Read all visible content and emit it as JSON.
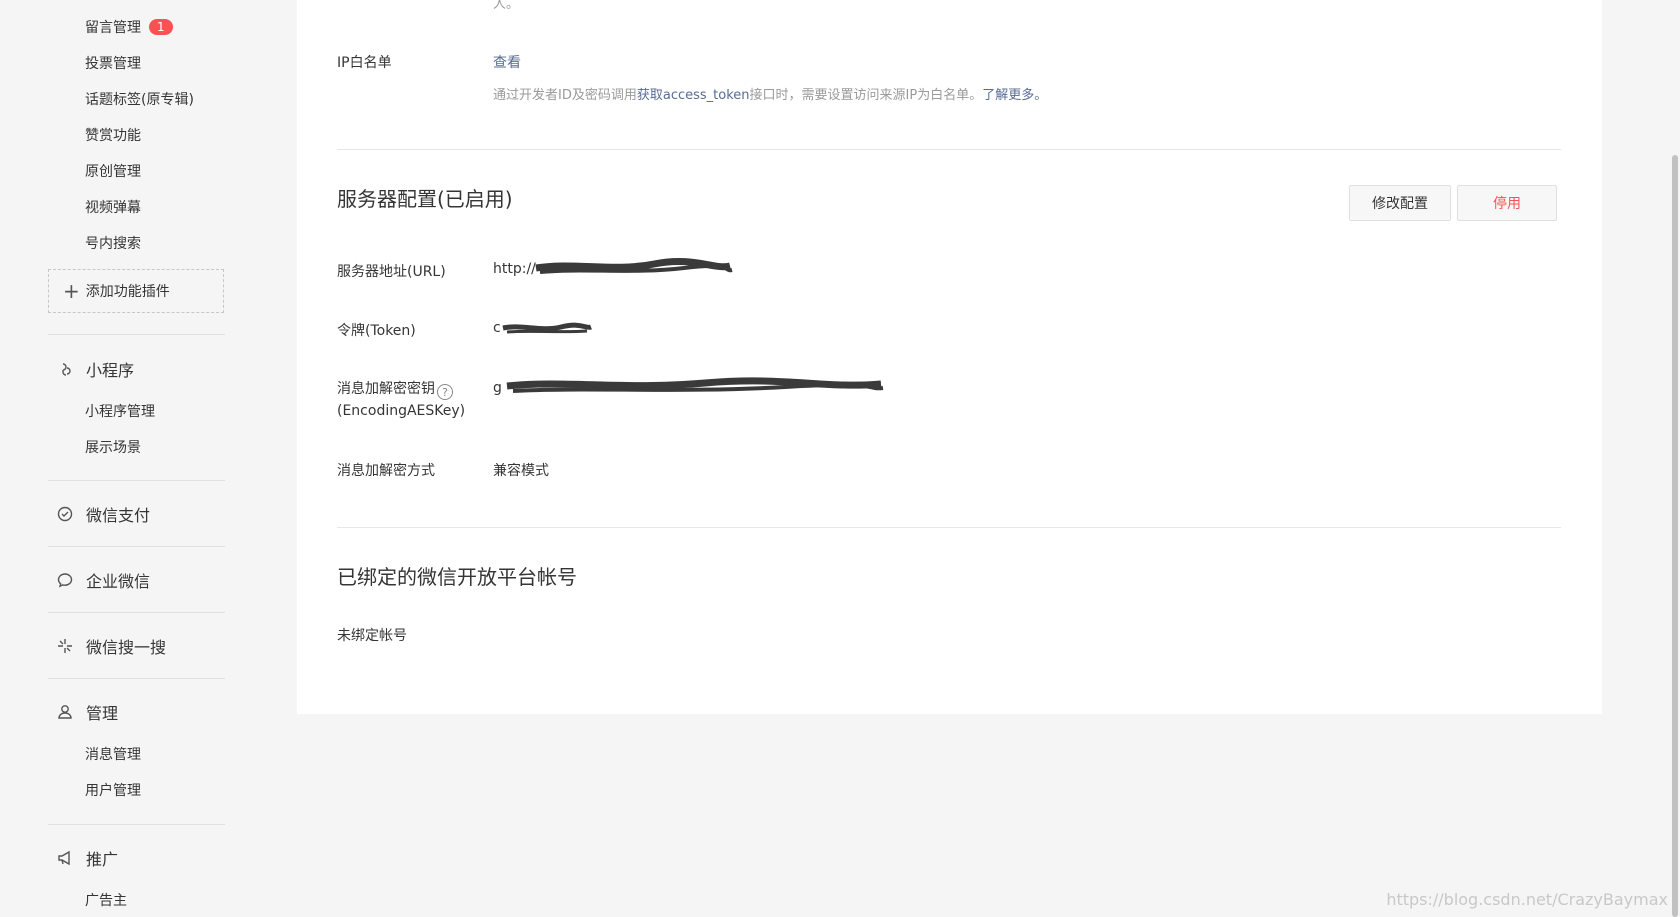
{
  "sidebar": {
    "sub_top": [
      {
        "label": "留言管理",
        "badge": "1"
      },
      {
        "label": "投票管理"
      },
      {
        "label": "话题标签(原专辑)"
      },
      {
        "label": "赞赏功能"
      },
      {
        "label": "原创管理"
      },
      {
        "label": "视频弹幕"
      },
      {
        "label": "号内搜索"
      }
    ],
    "add_plugin": "添加功能插件",
    "miniprogram": {
      "label": "小程序",
      "items": [
        "小程序管理",
        "展示场景"
      ]
    },
    "wechat_pay": "微信支付",
    "work_wechat": "企业微信",
    "wechat_search": "微信搜一搜",
    "manage": {
      "label": "管理",
      "items": [
        "消息管理",
        "用户管理"
      ]
    },
    "promote": {
      "label": "推广",
      "items": [
        "广告主"
      ]
    }
  },
  "main": {
    "top_cut_text": "人。",
    "ip_whitelist": {
      "label": "IP白名单",
      "view_link": "查看",
      "desc_prefix": "通过开发者ID及密码调用",
      "desc_link": "获取access_token",
      "desc_middle": "接口时，需要设置访问来源IP为白名单。",
      "learn_more": "了解更多。"
    },
    "server_config": {
      "title": "服务器配置(已启用)",
      "modify_btn": "修改配置",
      "disable_btn": "停用",
      "url_label": "服务器地址(URL)",
      "url_value": "http://",
      "token_label": "令牌(Token)",
      "token_value": "c",
      "aes_label_1": "消息加解密密钥",
      "aes_label_2": "(EncodingAESKey)",
      "aes_help": "?",
      "aes_value": "g",
      "mode_label": "消息加解密方式",
      "mode_value": "兼容模式"
    },
    "bound_accounts": {
      "title": "已绑定的微信开放平台帐号",
      "empty": "未绑定帐号"
    }
  },
  "watermark": "https://blog.csdn.net/CrazyBaymax",
  "colors": {
    "link": "#576b95",
    "danger": "#fa5151",
    "badge": "#fa5151"
  }
}
